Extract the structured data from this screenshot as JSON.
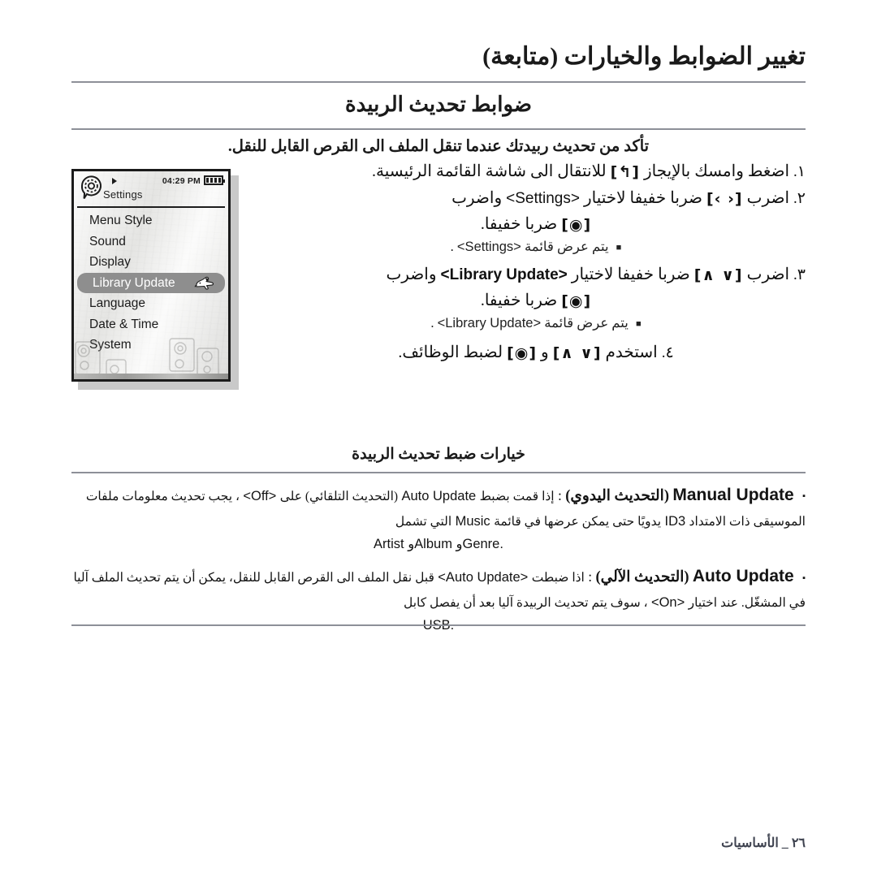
{
  "page": {
    "chapter_title": "تغيير الضوابط والخيارات (متابعة)",
    "section_title": "ضوابط تحديث الربيدة",
    "lead": "تأكد من تحديث ربيدتك عندما تنقل الملف الى القرص القابل للنقل."
  },
  "device": {
    "status": {
      "title": "Settings",
      "clock": "04:29 PM",
      "play_icon": "play-icon",
      "battery_icon": "battery-full-icon",
      "gear_icon": "gear-bubble-icon"
    },
    "menu": [
      {
        "label": "Menu Style",
        "selected": false
      },
      {
        "label": "Sound",
        "selected": false
      },
      {
        "label": "Display",
        "selected": false
      },
      {
        "label": "Library Update",
        "selected": true,
        "icon": "dog-icon"
      },
      {
        "label": "Language",
        "selected": false
      },
      {
        "label": "Date & Time",
        "selected": false
      },
      {
        "label": "System",
        "selected": false
      }
    ]
  },
  "steps": [
    {
      "num": "١.",
      "line1_a": "اضغط وامسك بالإيجاز",
      "key": "[↰]",
      "line1_b": "للانتقال الى شاشة القائمة الرئيسية."
    },
    {
      "num": "٢.",
      "line1_a": "اضرب",
      "key": "[‹ ›]",
      "line1_b": "ضربا خفيفا لاختيار",
      "target": "<Settings>",
      "line1_c": "واضرب",
      "line2_key": "[◉]",
      "line2_text": "ضربا خفيفا.",
      "bullet": "يتم عرض قائمة",
      "bullet_target": "<Settings>",
      "bullet_tail": "."
    },
    {
      "num": "٣.",
      "line1_a": "اضرب",
      "key": "[∧ ∨]",
      "line1_b": "ضربا خفيفا لاختيار",
      "target": "<Library Update>",
      "line1_c": "واضرب",
      "line2_key": "[◉]",
      "line2_text": "ضربا خفيفا.",
      "bullet": "يتم عرض قائمة",
      "bullet_target": "<Library Update>",
      "bullet_tail": "."
    },
    {
      "num": "٤.",
      "line1_a": "استخدم",
      "key": "[∧ ∨]",
      "line1_b": "و",
      "key2": "[◉]",
      "line1_c": "لضبط الوظائف."
    }
  ],
  "options": {
    "title": "خيارات ضبط تحديث الربيدة",
    "items": [
      {
        "bullet": "▪",
        "term_en": "Manual Update",
        "term_ar": "(التحديث اليدوي)",
        "colon": ":",
        "seg1": "إذا قمت بضبط",
        "seg2_en": "Auto Update",
        "seg3": "(التحديث التلقائي) على",
        "seg4_en": "<Off>",
        "seg5": "، يجب تحديث معلومات ملفات الموسيقى ذات الامتداد",
        "seg6_en": "ID3",
        "seg7": "يدويًا حتى يمكن عرضها في قائمة",
        "seg8_en": "Music",
        "seg9": "التي تشمل",
        "tail": "Artist وAlbum وGenre."
      },
      {
        "bullet": "▪",
        "term_en": "Auto Update",
        "term_ar": "(التحديث الآلي)",
        "colon": ":",
        "seg1": "اذا ضبطت",
        "seg2_en": "<Auto Update>",
        "seg3": "قبل نقل الملف الى القرص القابل للنقل، يمكن أن يتم تحديث الملف آليا في المشغّل. عند اختيار",
        "seg4_en": "<On>",
        "seg5": "، سوف يتم تحديث الربيدة آليا بعد أن يفصل كابل",
        "tail": "USB."
      }
    ]
  },
  "footer": {
    "text": "٢٦ _ الأساسيات"
  }
}
